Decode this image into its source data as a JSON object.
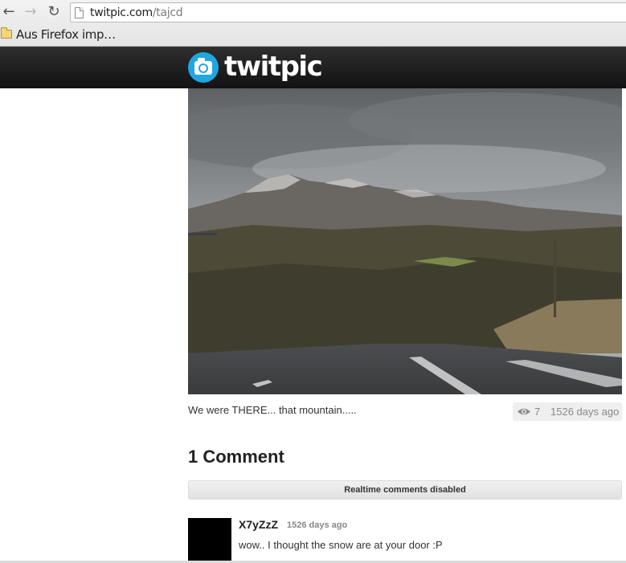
{
  "browser": {
    "url_host": "twitpic.com",
    "url_path": "/tajcd",
    "bookmark_label": "Aus Firefox imp…",
    "icons": [
      "back-arrow-icon",
      "forward-arrow-icon",
      "reload-icon",
      "page-icon",
      "folder-icon"
    ]
  },
  "site": {
    "logo_text": "twitpic",
    "brand_color": "#1fa7e0"
  },
  "photo": {
    "caption": "We were THERE... that mountain.....",
    "views": "7",
    "age": "1526 days ago"
  },
  "comments": {
    "title": "1 Comment",
    "realtime_notice": "Realtime comments disabled",
    "items": [
      {
        "user": "X7yZzZ",
        "time": "1526 days ago",
        "text": "wow.. I thought the snow are at your door :P"
      }
    ]
  }
}
